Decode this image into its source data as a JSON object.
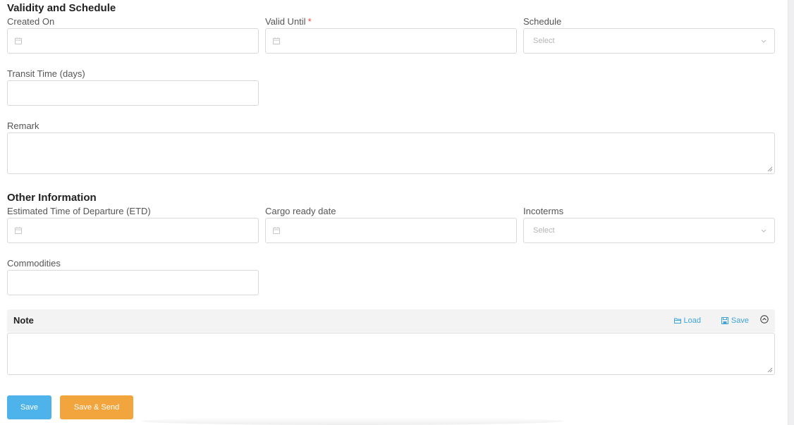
{
  "validity": {
    "title": "Validity and Schedule",
    "created_on": {
      "label": "Created On"
    },
    "valid_until": {
      "label": "Valid Until",
      "required_mark": "*"
    },
    "schedule": {
      "label": "Schedule",
      "placeholder": "Select"
    },
    "transit_time": {
      "label": "Transit Time (days)"
    },
    "remark": {
      "label": "Remark"
    }
  },
  "other": {
    "title": "Other Information",
    "etd": {
      "label": "Estimated Time of Departure (ETD)"
    },
    "cargo_ready": {
      "label": "Cargo ready date"
    },
    "incoterms": {
      "label": "Incoterms",
      "placeholder": "Select"
    },
    "commodities": {
      "label": "Commodities"
    }
  },
  "note": {
    "title": "Note",
    "load_label": "Load",
    "save_label": "Save"
  },
  "actions": {
    "save_label": "Save",
    "save_send_label": "Save & Send"
  },
  "colors": {
    "primary": "#4db3ea",
    "warning": "#f2a53c",
    "link": "#3ea4d8",
    "required": "#e74c3c"
  }
}
